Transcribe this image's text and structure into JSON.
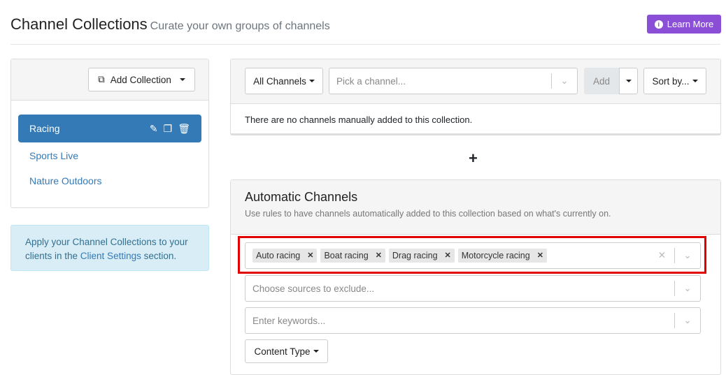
{
  "header": {
    "title": "Channel Collections",
    "subtitle": "Curate your own groups of channels",
    "learn_more": "Learn More"
  },
  "sidebar": {
    "add_collection": "Add Collection",
    "collections": [
      {
        "label": "Racing",
        "active": true
      },
      {
        "label": "Sports Live"
      },
      {
        "label": "Nature Outdoors"
      }
    ],
    "info": {
      "before": "Apply your Channel Collections to your clients in the ",
      "link": "Client Settings",
      "after": " section."
    }
  },
  "manual": {
    "filter": "All Channels",
    "pick_placeholder": "Pick a channel...",
    "add": "Add",
    "sort": "Sort by...",
    "empty": "There are no channels manually added to this collection."
  },
  "plus": "+",
  "automatic": {
    "title": "Automatic Channels",
    "description": "Use rules to have channels automatically added to this collection based on what's currently on.",
    "tags": [
      "Auto racing",
      "Boat racing",
      "Drag racing",
      "Motorcycle racing"
    ],
    "exclude_placeholder": "Choose sources to exclude...",
    "keywords_placeholder": "Enter keywords...",
    "content_type": "Content Type"
  },
  "colors": {
    "primary": "#337ab7",
    "learn": "#8a4fd6",
    "highlight": "#e00000"
  }
}
